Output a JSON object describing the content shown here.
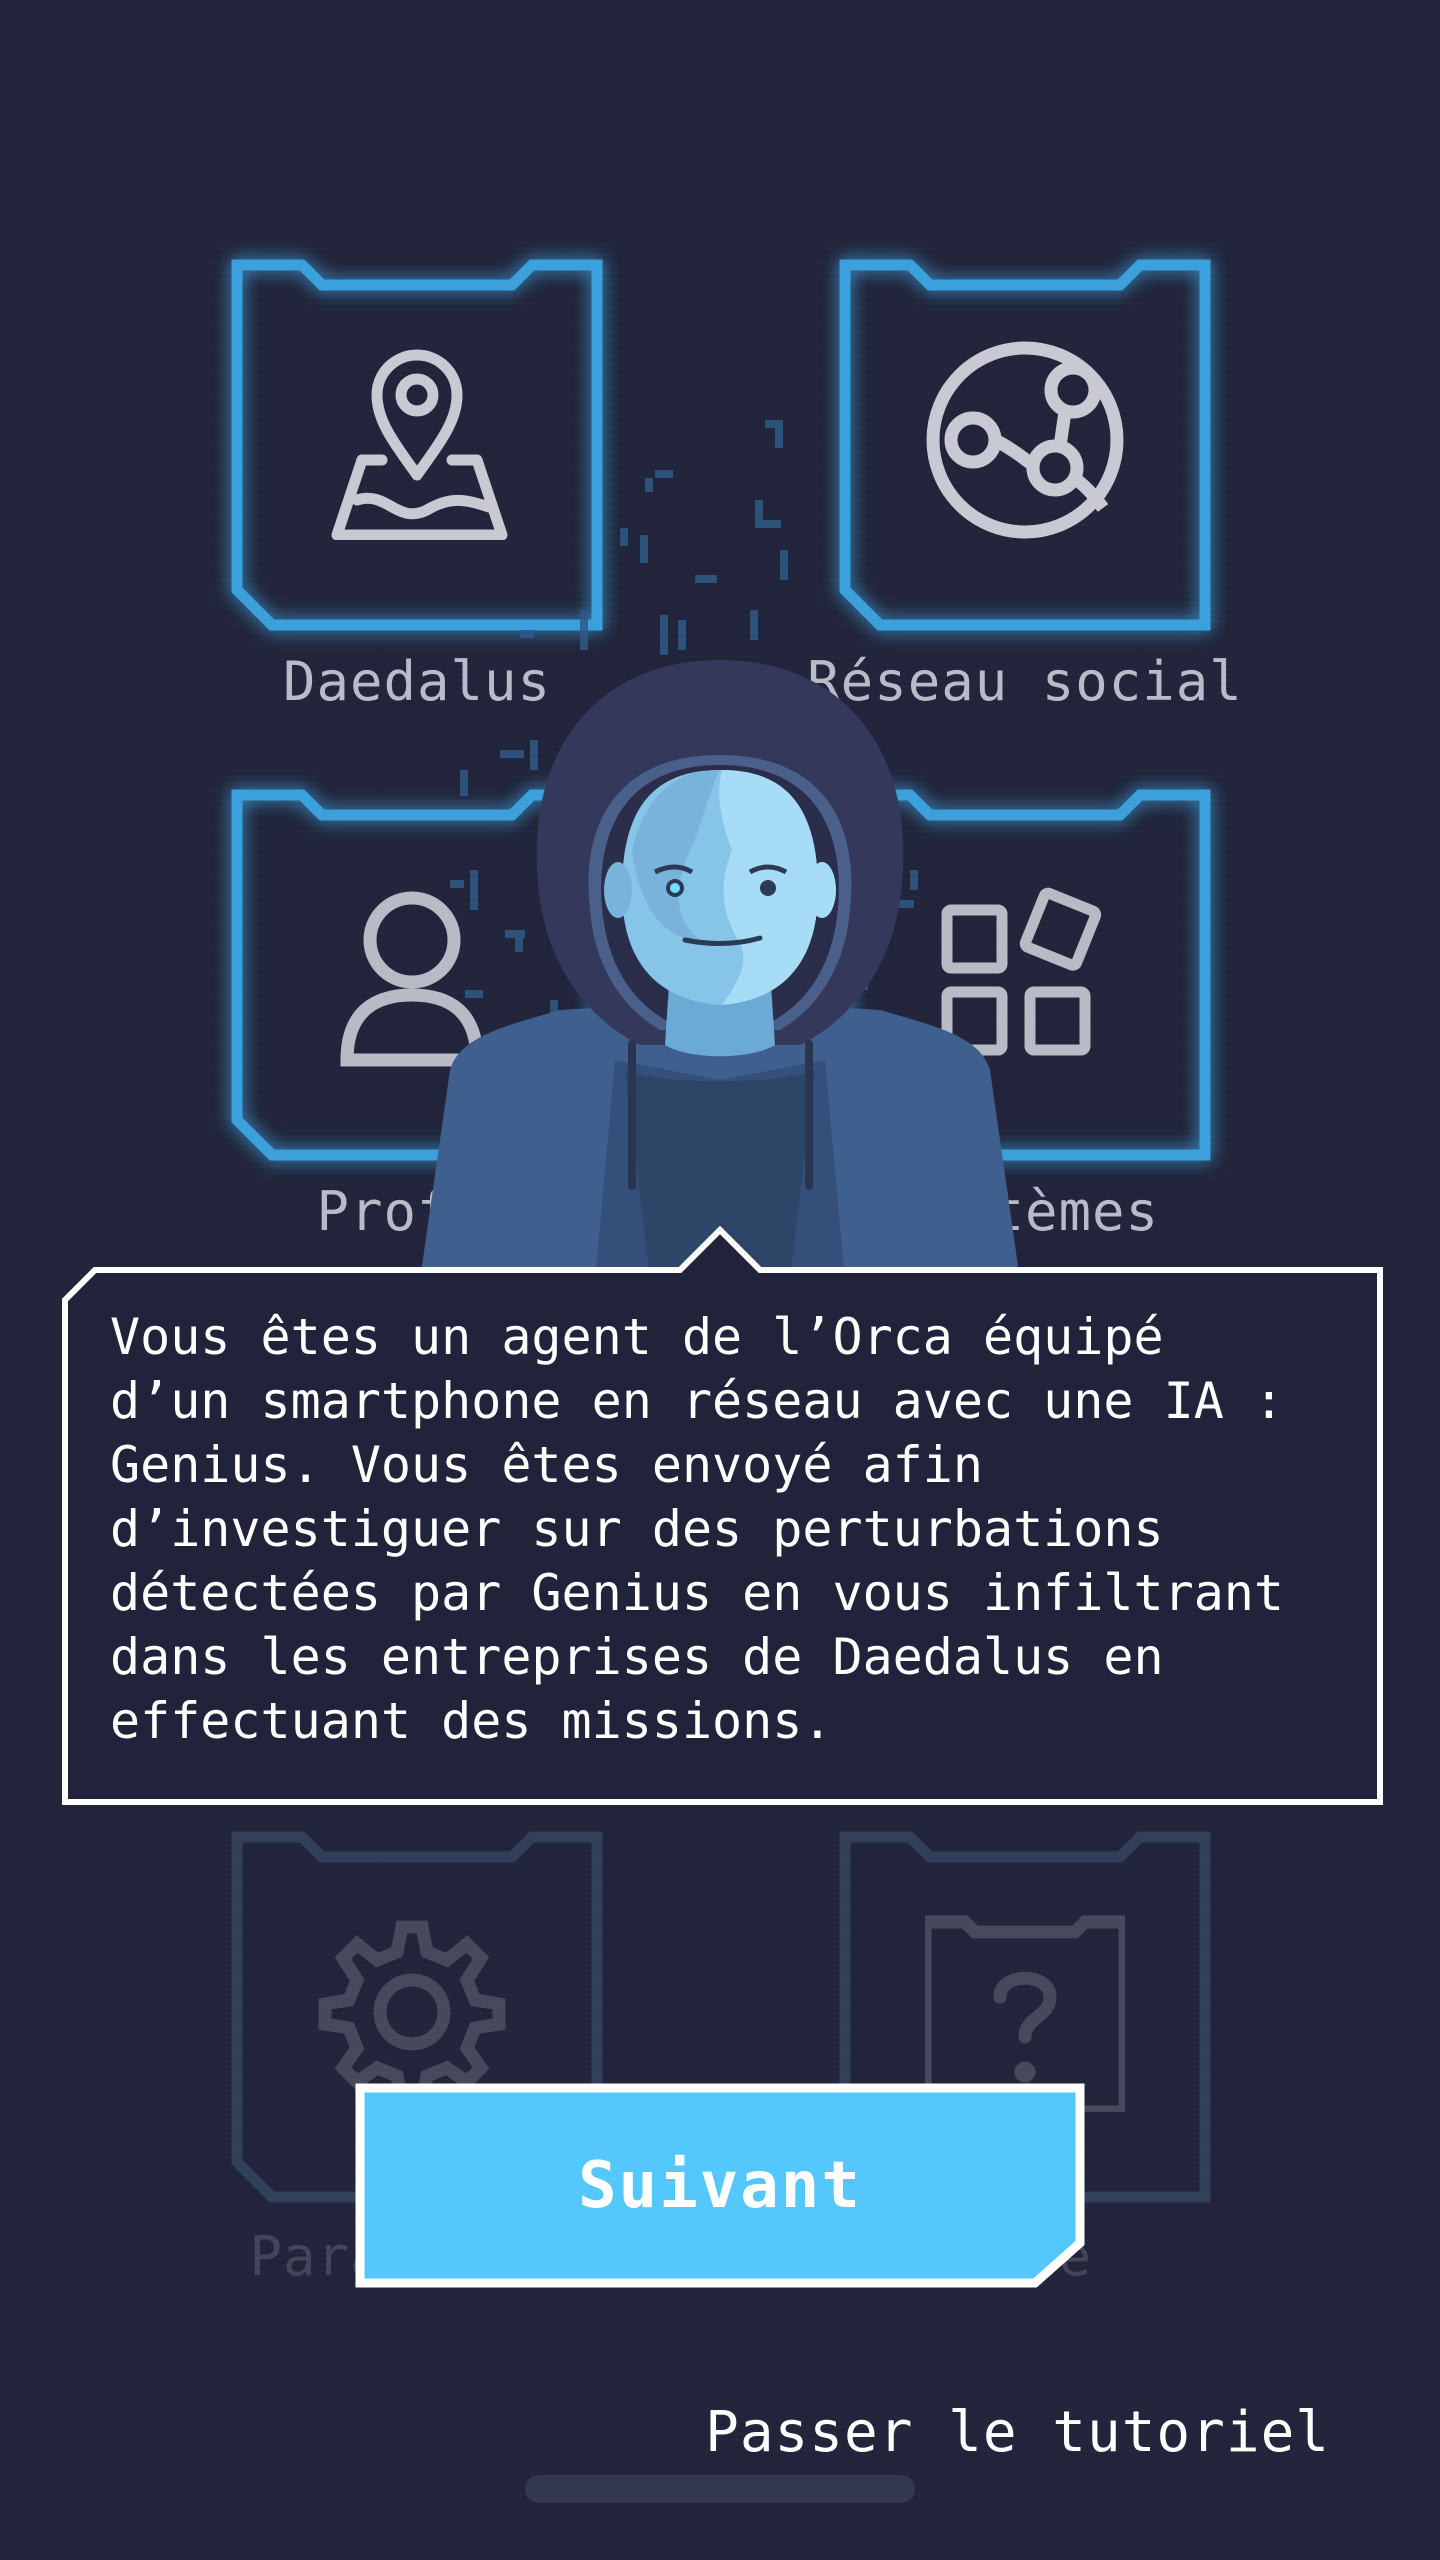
{
  "apps_top": [
    {
      "label": "Daedalus",
      "icon": "map-pin-icon"
    },
    {
      "label": "Réseau social",
      "icon": "network-globe-icon"
    },
    {
      "label": "Profil",
      "icon": "user-icon"
    },
    {
      "label": "Systèmes",
      "icon": "apps-grid-icon"
    }
  ],
  "apps_bottom": [
    {
      "label": "Paramètres",
      "icon": "gear-icon"
    },
    {
      "label": "Aide",
      "icon": "help-card-icon"
    }
  ],
  "tutorial": {
    "message": "Vous êtes un agent de l’Orca équipé\nd’un smartphone en réseau avec une IA :\nGenius. Vous êtes envoyé afin\nd’investiguer sur des perturbations\ndétectées par Genius en vous infiltrant\ndans les entreprises de Daedalus en\neffectuant des missions.",
    "next_label": "Suivant",
    "skip_label": "Passer le tutoriel"
  },
  "colors": {
    "background": "#21243a",
    "tile_border": "#3aa0dc",
    "button": "#54c8fc",
    "bubble_bg": "#20233a"
  }
}
